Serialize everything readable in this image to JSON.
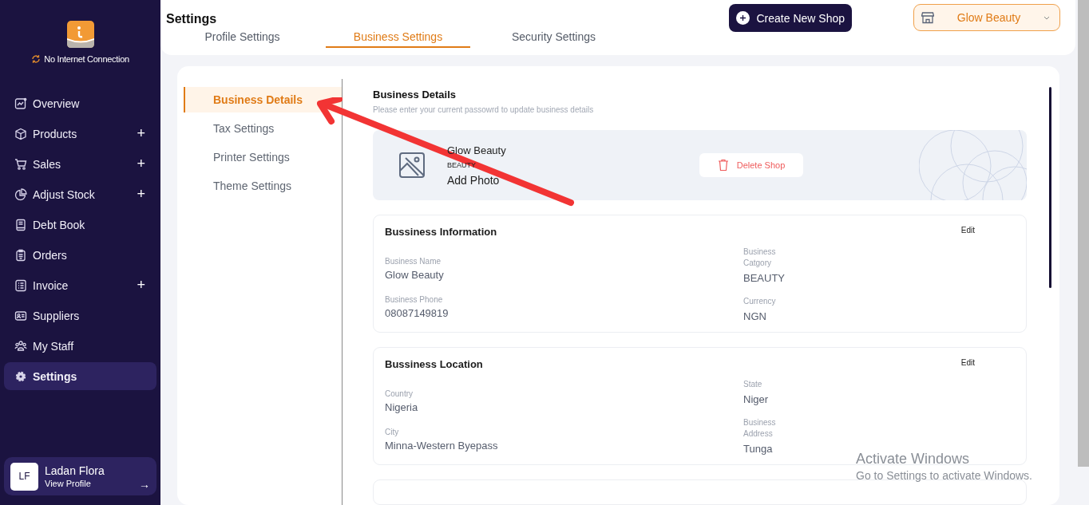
{
  "sidebar": {
    "status": "No Internet Connection",
    "items": [
      {
        "label": "Overview",
        "expandable": false,
        "selected": false
      },
      {
        "label": "Products",
        "expandable": true,
        "selected": false
      },
      {
        "label": "Sales",
        "expandable": true,
        "selected": false
      },
      {
        "label": "Adjust Stock",
        "expandable": true,
        "selected": false
      },
      {
        "label": "Debt Book",
        "expandable": false,
        "selected": false
      },
      {
        "label": "Orders",
        "expandable": false,
        "selected": false
      },
      {
        "label": "Invoice",
        "expandable": true,
        "selected": false
      },
      {
        "label": "Suppliers",
        "expandable": false,
        "selected": false
      },
      {
        "label": "My Staff",
        "expandable": false,
        "selected": false
      },
      {
        "label": "Settings",
        "expandable": false,
        "selected": true
      }
    ],
    "expand_symbol": "+",
    "user": {
      "initials": "LF",
      "name": "Ladan Flora",
      "link": "View Profile",
      "arrow": "→"
    }
  },
  "header": {
    "title": "Settings",
    "tabs": [
      {
        "label": "Profile Settings",
        "selected": false
      },
      {
        "label": "Business Settings",
        "selected": true
      },
      {
        "label": "Security Settings",
        "selected": false
      }
    ],
    "create_button": "Create New Shop",
    "shop_selector": "Glow Beauty"
  },
  "settings_menu": [
    {
      "label": "Business Details",
      "selected": true
    },
    {
      "label": "Tax Settings",
      "selected": false
    },
    {
      "label": "Printer Settings",
      "selected": false
    },
    {
      "label": "Theme Settings",
      "selected": false
    }
  ],
  "business_details": {
    "title": "Business Details",
    "subtitle": "Please enter your current passowrd to update business details",
    "shop": {
      "name": "Glow Beauty",
      "category": "BEAUTY",
      "add_photo": "Add Photo",
      "delete": "Delete Shop"
    },
    "sections": [
      {
        "title": "Bussiness Information",
        "edit": "Edit",
        "left": [
          {
            "label": "Business Name",
            "value": "Glow Beauty"
          },
          {
            "label": "Business Phone",
            "value": "08087149819"
          }
        ],
        "right": [
          {
            "label": "Business Catgory",
            "value": "BEAUTY"
          },
          {
            "label": "Currency",
            "value": "NGN"
          }
        ]
      },
      {
        "title": "Bussiness Location",
        "edit": "Edit",
        "left": [
          {
            "label": "Country",
            "value": "Nigeria"
          },
          {
            "label": "City",
            "value": "Minna-Western Byepass"
          }
        ],
        "right": [
          {
            "label": "State",
            "value": "Niger"
          },
          {
            "label": "Business Address",
            "value": "Tunga"
          }
        ]
      }
    ]
  },
  "os_notice": {
    "title": "Activate Windows",
    "text": "Go to Settings to activate Windows."
  }
}
